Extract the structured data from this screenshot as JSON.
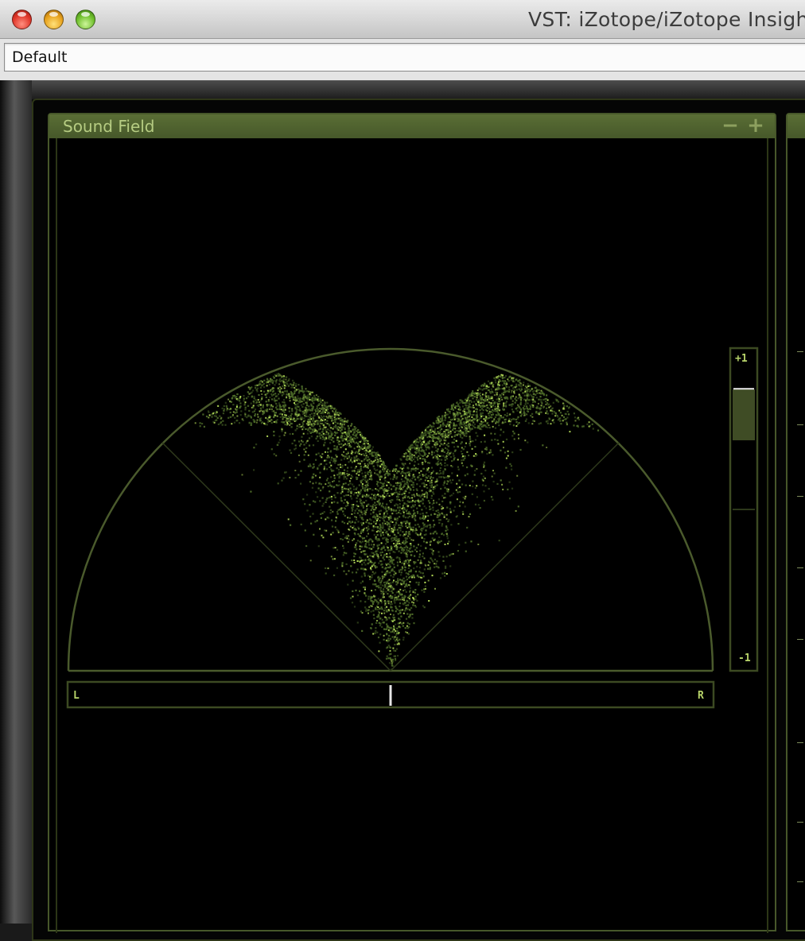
{
  "window": {
    "title": "VST: iZotope/iZotope Insight"
  },
  "preset": {
    "value": "Default"
  },
  "sound_field_panel": {
    "title": "Sound Field",
    "minimize_glyph": "−",
    "maximize_glyph": "+",
    "balance_meter": {
      "left_label": "L",
      "right_label": "R",
      "position": 0.5
    },
    "correlation_meter": {
      "top_label": "+1",
      "bottom_label": "-1",
      "value": 0.76
    }
  },
  "colors": {
    "panel_header": "#556a31",
    "panel_border": "#47572a",
    "title_text": "#b6cc82",
    "dot_bright": "#b8e05a",
    "dot_dim": "#4c6a28",
    "meter_indicator": "#e6e6e6"
  },
  "icons": {
    "close": "close-icon",
    "minimize": "minimize-icon",
    "zoom": "zoom-icon",
    "panel_minimize": "minus-icon",
    "panel_maximize": "plus-icon"
  }
}
